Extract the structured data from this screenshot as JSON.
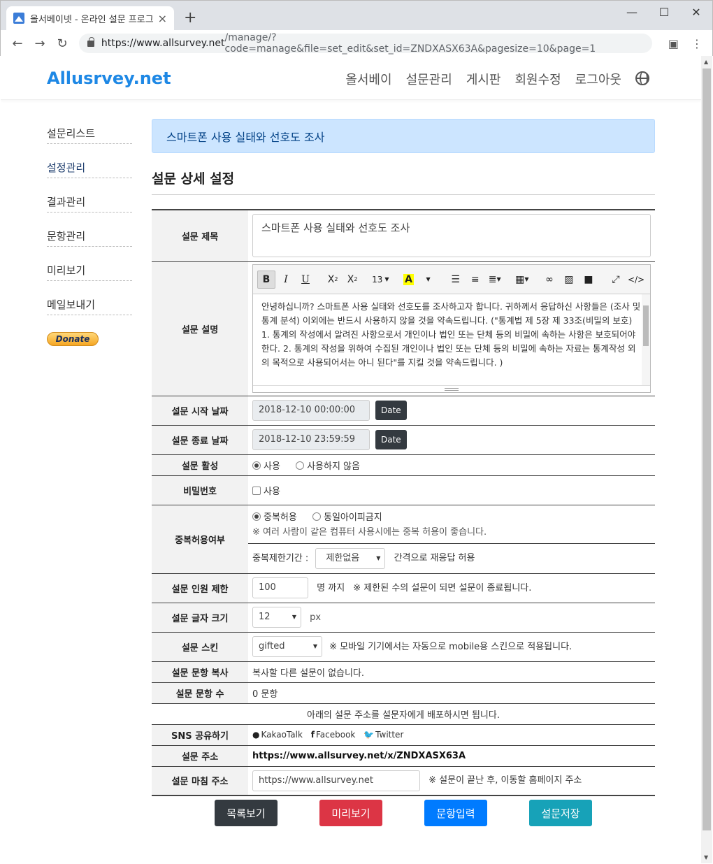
{
  "browser": {
    "tab_title": "올서베이넷 - 온라인 설문 프로그",
    "url_host": "https://www.allsurvey.net",
    "url_path": "/manage/?code=manage&file=set_edit&set_id=ZNDXASX63A&pagesize=10&page=1"
  },
  "header": {
    "logo": "Allusrvey.net",
    "nav": [
      "올서베이",
      "설문관리",
      "게시판",
      "회원수정",
      "로그아웃"
    ]
  },
  "sidebar": {
    "items": [
      "설문리스트",
      "설정관리",
      "결과관리",
      "문항관리",
      "미리보기",
      "메일보내기"
    ],
    "donate": "Donate"
  },
  "main": {
    "alert": "스마트폰 사용 실태와 선호도 조사",
    "heading": "설문 상세 설정"
  },
  "form": {
    "title_label": "설문 제목",
    "title_value": "스마트폰 사용 실태와 선호도 조사",
    "desc_label": "설문 설명",
    "font_size": "13",
    "desc_value": "안녕하십니까? 스마트폰 사용 실태와 선호도를 조사하고자 합니다. 귀하께서 응답하신 사항들은 (조사 및 통계 분석) 이외에는 반드시 사용하지 않을 것을 약속드립니다. (\"통계법 제 5장 제 33조(비밀의 보호) 1. 통계의 작성에서 알려진 사항으로서 개인이나 법인 또는 단체 등의 비밀에 속하는 사항은 보호되어야 한다. 2. 통계의 작성을 위하여 수집된 개인이나 법인 또는 단체 등의 비밀에 속하는 자료는 통계작성 외의 목적으로 사용되어서는 아니 된다\"를 지킬 것을 약속드립니다. )",
    "start_label": "설문 시작 날짜",
    "start_value": "2018-12-10 00:00:00",
    "end_label": "설문 종료 날짜",
    "end_value": "2018-12-10 23:59:59",
    "date_btn": "Date",
    "active_label": "설문 활성",
    "active_opts": [
      "사용",
      "사용하지 않음"
    ],
    "pw_label": "비밀번호",
    "pw_opt": "사용",
    "dup_label": "중복허용여부",
    "dup_opts": [
      "중복허용",
      "동일아이피금지"
    ],
    "dup_note": "※ 여러 사람이 같은 컴퓨터 사용시에는 중복 허용이 좋습니다.",
    "dup_period_label": "중복제한기간 :",
    "dup_period_value": "제한없음",
    "dup_period_suffix": "간격으로 재응답 허용",
    "limit_label": "설문 인원 제한",
    "limit_value": "100",
    "limit_unit": "명 까지",
    "limit_note": "※ 제한된 수의 설문이 되면 설문이 종료됩니다.",
    "fontsize_label": "설문 글자 크기",
    "fontsize_value": "12",
    "fontsize_unit": "px",
    "skin_label": "설문 스킨",
    "skin_value": "gifted",
    "skin_note": "※ 모바일 기기에서는 자동으로 mobile용 스킨으로 적용됩니다.",
    "copy_label": "설문 문항 복사",
    "copy_value": "복사할 다른 설문이 없습니다.",
    "count_label": "설문 문항 수",
    "count_value": "0 문항",
    "share_note": "아래의 설문 주소를 설문자에게 배포하시면 됩니다.",
    "sns_label": "SNS 공유하기",
    "sns": [
      "KakaoTalk",
      "Facebook",
      "Twitter"
    ],
    "addr_label": "설문 주소",
    "addr_value": "https://www.allsurvey.net/x/ZNDXASX63A",
    "finish_label": "설문 마침 주소",
    "finish_value": "https://www.allsurvey.net",
    "finish_note": "※ 설문이 끝난 후, 이동할 홈페이지 주소"
  },
  "buttons": {
    "list": "목록보기",
    "preview": "미리보기",
    "questions": "문항입력",
    "save": "설문저장"
  },
  "colors": {
    "list": "#343a40",
    "preview": "#dc3545",
    "questions": "#007bff",
    "save": "#17a2b8"
  }
}
